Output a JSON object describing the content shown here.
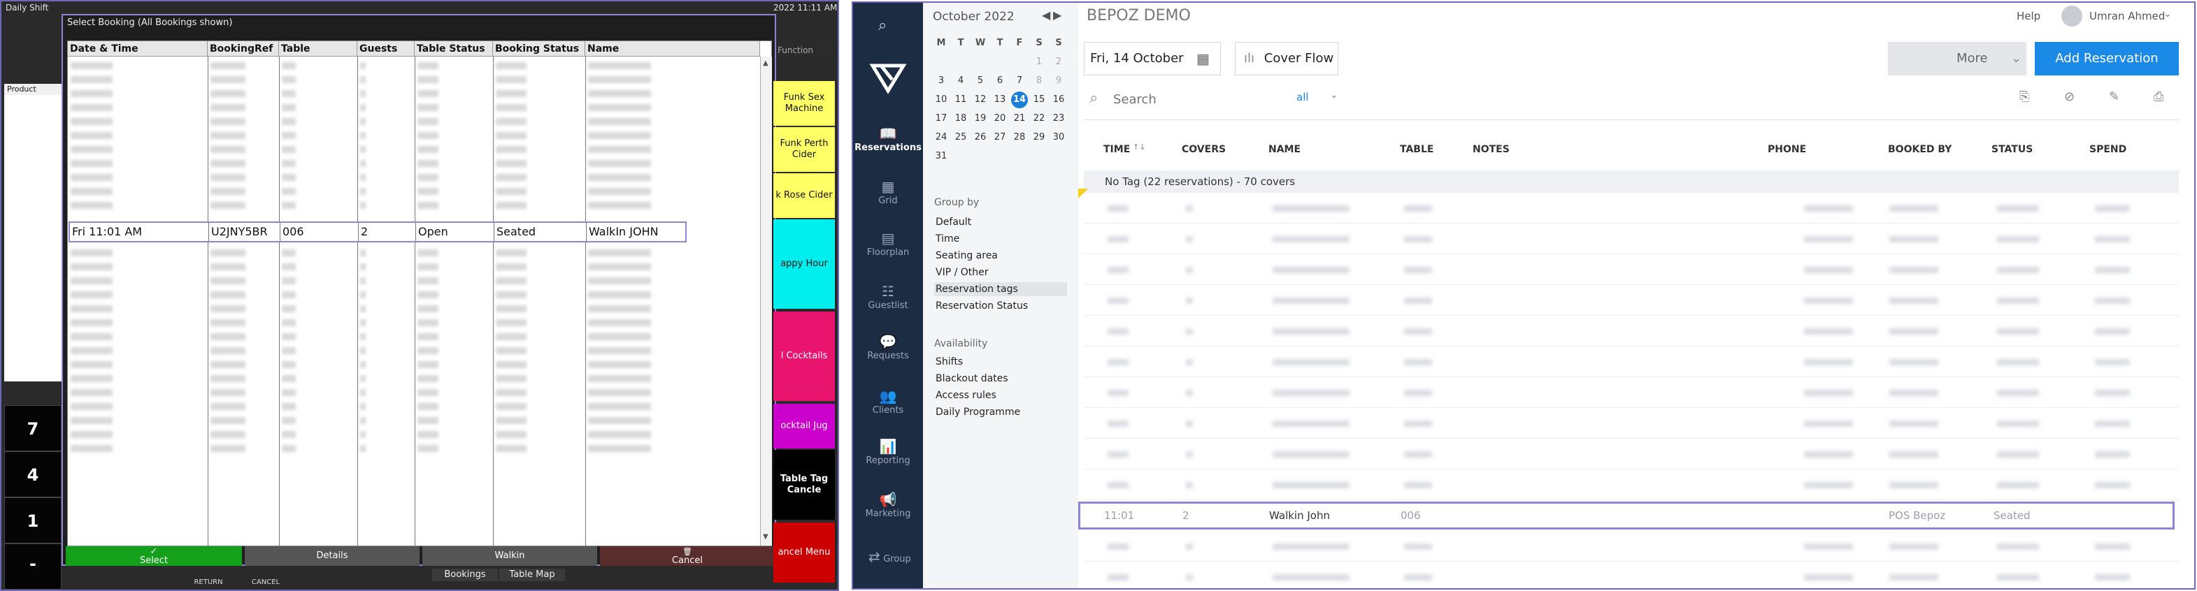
{
  "pos": {
    "window_title": "Daily Shift",
    "top_right_text": "2022 11:11 AM",
    "product_label": "Product",
    "function_header": "Function",
    "function_buttons": [
      {
        "label": "Funk Sex Machine",
        "color": "#ffff66"
      },
      {
        "label": "Funk Perth Cider",
        "color": "#ffff66"
      },
      {
        "label": "k Rose Cider",
        "color": "#ffff66"
      },
      {
        "label": "appy Hour",
        "color": "#00eeee"
      },
      {
        "label": "l Cocktails",
        "color": "#e8146e"
      },
      {
        "label": "ocktail Jug",
        "color": "#cc00cc"
      },
      {
        "label": "Table Tag Cancle",
        "color": "#000000"
      },
      {
        "label": "ancel Menu",
        "color": "#cc0000"
      }
    ],
    "keypad": [
      "7",
      "4",
      "1",
      "-"
    ],
    "bottom_links": [
      "Bookings",
      "Table Map"
    ],
    "bottom_small": [
      "RETURN",
      "CANCEL"
    ],
    "modal": {
      "title": "Select Booking  (All Bookings shown)",
      "columns": [
        "Date & Time",
        "BookingRef",
        "Table",
        "Guests",
        "Table Status",
        "Booking Status",
        "Name"
      ],
      "selected_row": [
        "Fri 11:01 AM",
        "U2JNY5BR",
        "006",
        "2",
        "Open",
        "Seated",
        "WalkIn JOHN"
      ],
      "buttons": [
        {
          "label": "Select",
          "icon": "check-icon",
          "color": "#14a01a"
        },
        {
          "label": "Details",
          "color": "#555555"
        },
        {
          "label": "Walkin",
          "color": "#555555"
        },
        {
          "label": "Cancel",
          "icon": "trash-icon",
          "color": "#5a2d2d"
        }
      ]
    }
  },
  "rez": {
    "brand": "BEPOZ DEMO",
    "help": "Help",
    "user": "Umran Ahmed",
    "nav": [
      "Reservations",
      "Grid",
      "Floorplan",
      "Guestlist",
      "Requests",
      "Clients",
      "Reporting",
      "Marketing",
      "Group"
    ],
    "calendar": {
      "month": "October 2022",
      "weekdays": [
        "M",
        "T",
        "W",
        "T",
        "F",
        "S",
        "S"
      ],
      "weeks": [
        [
          "",
          "",
          "",
          "",
          "",
          "1",
          "2"
        ],
        [
          "3",
          "4",
          "5",
          "6",
          "7",
          "8",
          "9"
        ],
        [
          "10",
          "11",
          "12",
          "13",
          "14",
          "15",
          "16"
        ],
        [
          "17",
          "18",
          "19",
          "20",
          "21",
          "22",
          "23"
        ],
        [
          "24",
          "25",
          "26",
          "27",
          "28",
          "29",
          "30"
        ],
        [
          "31",
          "",
          "",
          "",
          "",
          "",
          ""
        ]
      ],
      "today": "14"
    },
    "group_by_title": "Group by",
    "group_by": [
      "Default",
      "Time",
      "Seating area",
      "VIP / Other",
      "Reservation tags",
      "Reservation Status"
    ],
    "group_by_selected": "Reservation tags",
    "availability_title": "Availability",
    "availability": [
      "Shifts",
      "Blackout dates",
      "Access rules",
      "Daily Programme"
    ],
    "date_value": "Fri, 14 October",
    "cover_flow": "Cover Flow",
    "more": "More",
    "add_reservation": "Add Reservation",
    "search_placeholder": "Search",
    "search_filter": "all",
    "columns": [
      "TIME",
      "COVERS",
      "NAME",
      "TABLE",
      "NOTES",
      "PHONE",
      "BOOKED BY",
      "STATUS",
      "SPEND"
    ],
    "group_label": "No Tag (22 reservations) - 70 covers",
    "selected_row": {
      "time": "11:01",
      "covers": "2",
      "name": "Walkin John",
      "table": "006",
      "booked_by": "POS Bepoz",
      "status": "Seated"
    },
    "accent": "#1b8ae6"
  }
}
